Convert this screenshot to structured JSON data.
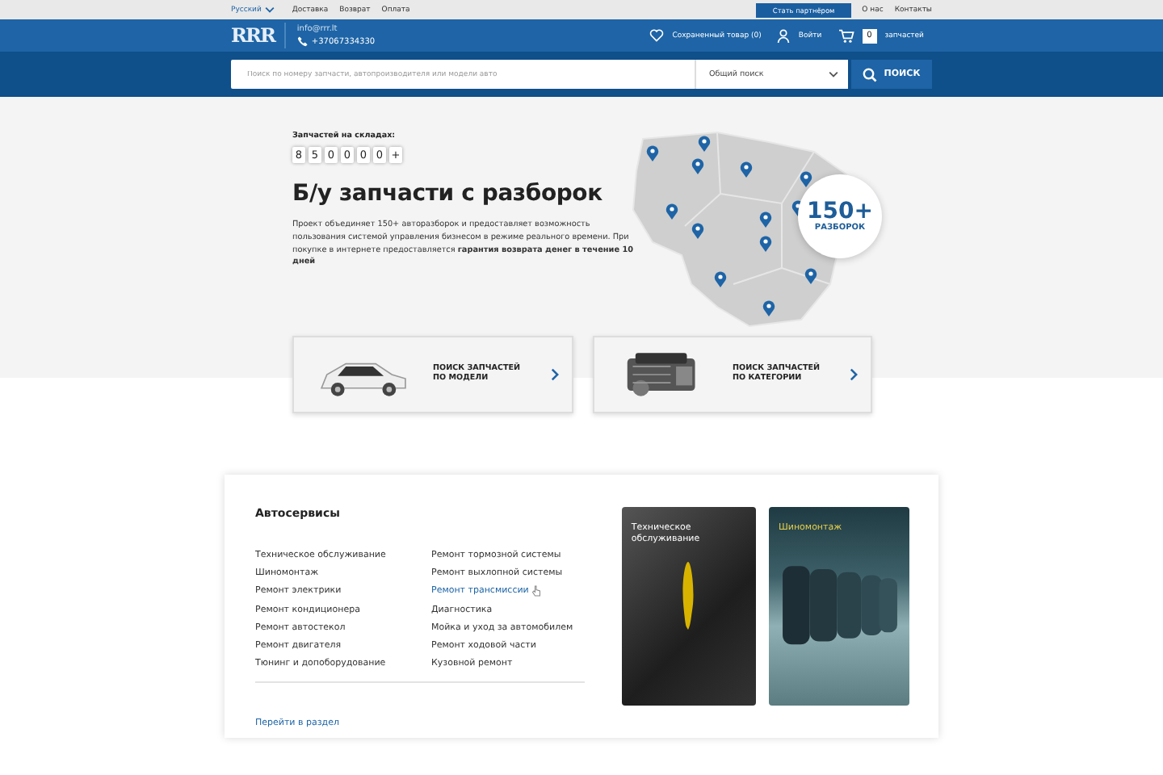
{
  "top_bar": {
    "language": "Русский",
    "links": [
      "Доставка",
      "Возврат",
      "Оплата"
    ],
    "partner_button": "Стать партнёром",
    "right_links": [
      "О нас",
      "Контакты"
    ]
  },
  "header": {
    "logo": "RRR",
    "email": "info@rrr.lt",
    "phone": "+37067334330",
    "saved": "Сохраненный товар (0)",
    "login": "Войти",
    "cart_count": "0",
    "cart_label": "запчастей"
  },
  "search": {
    "placeholder": "Поиск по номеру запчасти, автопроизводителя или модели авто",
    "select": "Общий поиск",
    "button": "ПОИСК"
  },
  "hero": {
    "stock_label": "Запчастей на складах:",
    "digits": [
      "8",
      "5",
      "0",
      "0",
      "0",
      "0",
      "+"
    ],
    "title": "Б/у запчасти с разборок",
    "text": "Проект объединяет 150+ авторазборок и предоставляет возможность пользования системой управления бизнесом в режиме реального времени. При покупке в интернете предоставляется **гарантия возврата денег в течение 10 дней**",
    "badge_number": "150+",
    "badge_label": "РАЗБОРОК"
  },
  "search_cards": [
    {
      "kind": "car",
      "label": "ПОИСК ЗАПЧАСТЕЙ ПО МОДЕЛИ"
    },
    {
      "kind": "engine",
      "label": "ПОИСК ЗАПЧАСТЕЙ ПО КАТЕГОРИИ"
    }
  ],
  "services": {
    "title": "Автосервисы",
    "columns": [
      [
        {
          "label": "Техническое обслуживание",
          "highlighted": false
        },
        {
          "label": "Шиномонтаж",
          "highlighted": false
        },
        {
          "label": "Ремонт электрики",
          "highlighted": false
        },
        {
          "label": "Ремонт кондиционера",
          "highlighted": false
        },
        {
          "label": "Ремонт автостекол",
          "highlighted": false
        },
        {
          "label": "Ремонт двигателя",
          "highlighted": false
        },
        {
          "label": "Тюнинг и допоборудование",
          "highlighted": false
        }
      ],
      [
        {
          "label": "Ремонт тормозной системы",
          "highlighted": false
        },
        {
          "label": "Ремонт выхлопной системы",
          "highlighted": false
        },
        {
          "label": "Ремонт трансмиссии",
          "highlighted": true
        },
        {
          "label": "Диагностика",
          "highlighted": false
        },
        {
          "label": "Мойка и уход за автомобилем",
          "highlighted": false
        },
        {
          "label": "Ремонт ходовой части",
          "highlighted": false
        },
        {
          "label": "Кузовной ремонт",
          "highlighted": false
        }
      ]
    ],
    "link": "Перейти в раздел",
    "tiles": [
      {
        "kind": "oil",
        "label": "Техническое обслуживание"
      },
      {
        "kind": "tires",
        "label": "Шиномонтаж"
      }
    ]
  }
}
